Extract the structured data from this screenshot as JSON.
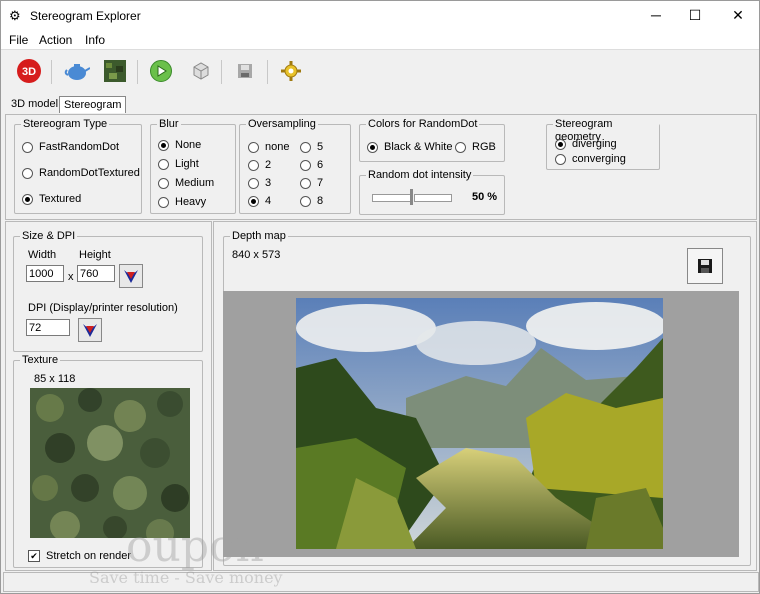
{
  "window": {
    "title": "Stereogram Explorer"
  },
  "menu": [
    "File",
    "Action",
    "Info"
  ],
  "tabs": [
    "3D model",
    "Stereogram"
  ],
  "stereogram_type": {
    "label": "Stereogram Type",
    "options": [
      "FastRandomDot",
      "RandomDotTextured",
      "Textured"
    ],
    "selected": "Textured"
  },
  "blur": {
    "label": "Blur",
    "options": [
      "None",
      "Light",
      "Medium",
      "Heavy"
    ],
    "selected": "None"
  },
  "oversampling": {
    "label": "Oversampling",
    "options": [
      "none",
      "2",
      "3",
      "4",
      "5",
      "6",
      "7",
      "8"
    ],
    "selected": "4"
  },
  "colors": {
    "label": "Colors for RandomDot",
    "options": [
      "Black & White",
      "RGB"
    ],
    "selected": "Black & White"
  },
  "intensity": {
    "label": "Random dot intensity",
    "value_text": "50 %",
    "value": 50
  },
  "geometry": {
    "label": "Stereogram geometry",
    "options": [
      "diverging",
      "converging"
    ],
    "selected": "diverging"
  },
  "size": {
    "label": "Size & DPI",
    "width_label": "Width",
    "height_label": "Height",
    "width": "1000",
    "height": "760",
    "x": "x",
    "dpi_label": "DPI (Display/printer resolution)",
    "dpi": "72"
  },
  "texture": {
    "label": "Texture",
    "dims": "85 x 118",
    "stretch_label": "Stretch on render",
    "stretch": true
  },
  "depth": {
    "label": "Depth map",
    "dims": "840 x 573"
  },
  "watermark": {
    "brand": "oupon",
    "tagline": "Save time - Save money"
  }
}
